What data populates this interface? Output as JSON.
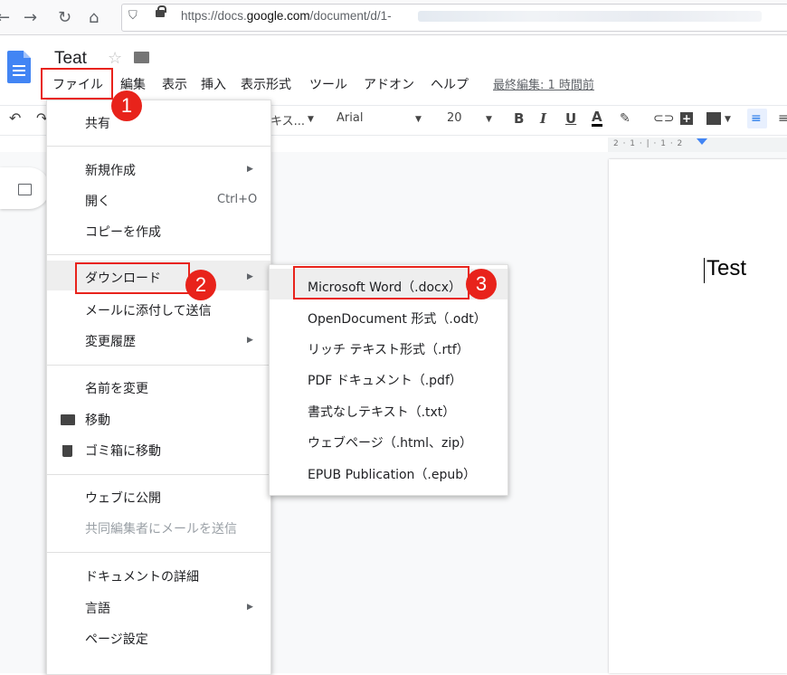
{
  "browser": {
    "url_prefix": "https://docs.",
    "url_domain": "google.com",
    "url_path": "/document/d/1-"
  },
  "docs": {
    "title": "Teat",
    "menus": [
      "ファイル",
      "編集",
      "表示",
      "挿入",
      "表示形式",
      "ツール",
      "アドオン",
      "ヘルプ"
    ],
    "last_edit": "最終編集: 1 時間前"
  },
  "toolbar": {
    "style_label": "テキス...",
    "font": "Arial",
    "size": "20",
    "bold": "B",
    "italic": "I",
    "underline": "U",
    "textcolor": "A"
  },
  "ruler": {
    "text": "2 · 1 · | · 1 · 2"
  },
  "document": {
    "text": "Test"
  },
  "file_menu": {
    "share": "共有",
    "new": "新規作成",
    "open": "開く",
    "open_shortcut": "Ctrl+O",
    "copy": "コピーを作成",
    "download": "ダウンロード",
    "email_attach": "メールに添付して送信",
    "history": "変更履歴",
    "rename": "名前を変更",
    "move": "移動",
    "trash": "ゴミ箱に移動",
    "publish": "ウェブに公開",
    "email_collab": "共同編集者にメールを送信",
    "details": "ドキュメントの詳細",
    "language": "言語",
    "page_setup": "ページ設定"
  },
  "download_menu": [
    "Microsoft Word（.docx）",
    "OpenDocument 形式（.odt）",
    "リッチ テキスト形式（.rtf）",
    "PDF ドキュメント（.pdf）",
    "書式なしテキスト（.txt）",
    "ウェブページ（.html、zip）",
    "EPUB Publication（.epub）"
  ],
  "badges": [
    "1",
    "2",
    "3"
  ],
  "colors": {
    "accent": "#e8231b",
    "docs_blue": "#4285f4"
  }
}
